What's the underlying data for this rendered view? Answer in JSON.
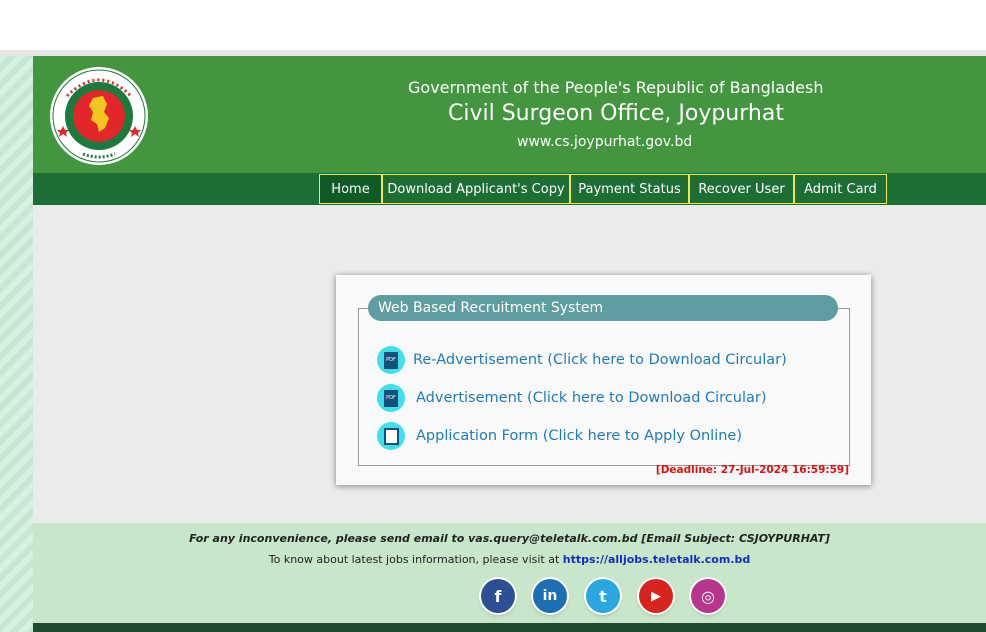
{
  "header": {
    "gov_title": "Government of the People's Republic of Bangladesh",
    "office_title": "Civil Surgeon Office, Joypurhat",
    "website": "www.cs.joypurhat.gov.bd",
    "seal_text_top": "গণপ্রজাতন্ত্রী বাংলাদেশ",
    "seal_text_bottom": "সরকার"
  },
  "nav": {
    "items": [
      {
        "label": "Home"
      },
      {
        "label": "Download Applicant's Copy"
      },
      {
        "label": "Payment Status"
      },
      {
        "label": "Recover User"
      },
      {
        "label": "Admit Card"
      }
    ]
  },
  "panel": {
    "title": "Web Based Recruitment System",
    "links": [
      {
        "label": "Re-Advertisement (Click here to Download Circular)",
        "icon": "pdf-icon"
      },
      {
        "label": "Advertisement (Click here to Download Circular)",
        "icon": "pdf-icon"
      },
      {
        "label": "Application Form (Click here to Apply Online)",
        "icon": "form-icon"
      }
    ],
    "deadline": "[Deadline: 27-Jul-2024 16:59:59]"
  },
  "footer": {
    "contact": "For any inconvenience, please send email to vas.query@teletalk.com.bd [Email Subject: CSJOYPURHAT]",
    "jobs_text": "To know about latest jobs information, please visit at",
    "jobs_link": "https://alljobs.teletalk.com.bd",
    "social": [
      {
        "name": "facebook",
        "glyph": "f",
        "color": "#2d4f93"
      },
      {
        "name": "linkedin",
        "glyph": "in",
        "color": "#1c6fb3"
      },
      {
        "name": "twitter",
        "glyph": "t",
        "color": "#2aa7e0"
      },
      {
        "name": "youtube",
        "glyph": "▶",
        "color": "#d9231e"
      },
      {
        "name": "instagram",
        "glyph": "◎",
        "color": "#b8358e"
      }
    ]
  },
  "colors": {
    "header_green": "#43963f",
    "nav_green": "#1d6e35",
    "legend_teal": "#5f9ea0",
    "link_blue": "#1d7bbd",
    "deadline_red": "#e01010"
  }
}
